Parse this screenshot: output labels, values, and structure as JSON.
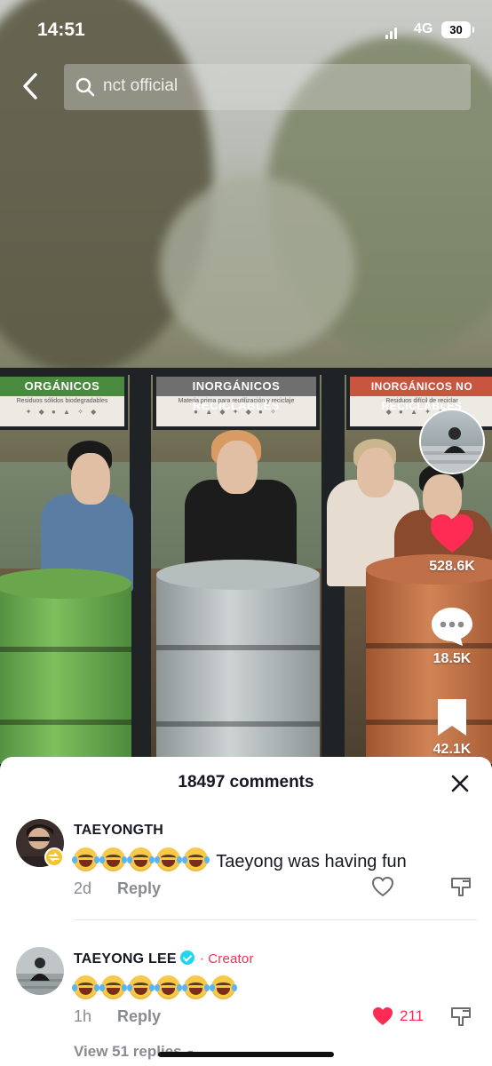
{
  "status_bar": {
    "time": "14:51",
    "network": "4G",
    "battery": "30"
  },
  "search": {
    "query": "nct official"
  },
  "video": {
    "signs": [
      "ORGÁNICOS",
      "INORGÁNICOS RECICLABLES",
      "INORGÁNICOS NO RECICLABLES"
    ],
    "sign_subtitles": [
      "Residuos sólidos biodegradables",
      "Materia prima para reutilización y reciclaje",
      "Residuos difícil de reciclar"
    ]
  },
  "rail": {
    "likes": "528.6K",
    "comments": "18.5K",
    "saves": "42.1K"
  },
  "comments_sheet": {
    "title": "18497 comments",
    "comments": [
      {
        "username": "TAEYONGTH",
        "emoji_count": 5,
        "text": "Taeyong was having fun",
        "time": "2d",
        "reply_label": "Reply",
        "likes": ""
      },
      {
        "username": "TAEYONG LEE",
        "creator_label": "Creator",
        "emoji_count": 6,
        "text": "",
        "time": "1h",
        "reply_label": "Reply",
        "likes": "211",
        "view_replies": "View 51 replies"
      }
    ]
  },
  "colors": {
    "accent": "#fe2c55",
    "verified": "#20d5ec",
    "like_red": "#fe2c55"
  }
}
